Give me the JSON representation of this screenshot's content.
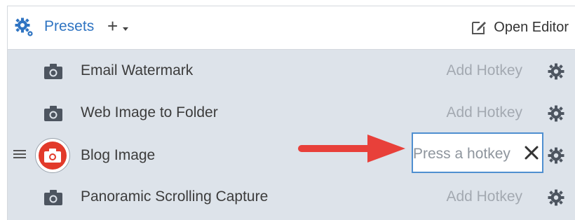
{
  "header": {
    "presets_label": "Presets",
    "add_symbol": "+",
    "open_editor_label": "Open Editor"
  },
  "presets": [
    {
      "name": "Email Watermark",
      "hotkey": "Add Hotkey"
    },
    {
      "name": "Web Image to Folder",
      "hotkey": "Add Hotkey"
    },
    {
      "name": "Blog Image",
      "hotkey_placeholder": "Press a hotkey",
      "editing": true
    },
    {
      "name": "Panoramic Scrolling Capture",
      "hotkey": "Add Hotkey"
    }
  ],
  "icons": {
    "header_left": "gears-icon",
    "header_right": "edit-icon",
    "row_type": "camera-icon",
    "row_settings": "gear-icon",
    "drag": "drag-handle-icon",
    "clear": "close-icon",
    "annotation": "arrow-right-icon"
  },
  "colors": {
    "accent_blue": "#2f74c2",
    "selected_red": "#e23a2a",
    "arrow_red": "#e8403a",
    "list_background": "#dde3ea",
    "focus_border": "#4f8fd0"
  }
}
